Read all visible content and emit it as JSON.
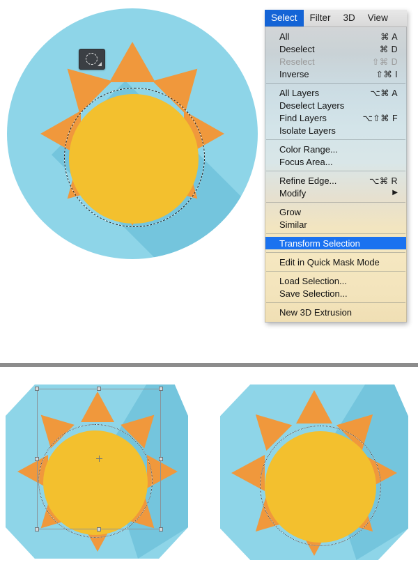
{
  "app": {
    "context": "Adobe Photoshop — Select menu open over a flat sun icon illustration"
  },
  "menubar": {
    "items": [
      {
        "label": "Select",
        "active": true
      },
      {
        "label": "Filter",
        "active": false
      },
      {
        "label": "3D",
        "active": false
      },
      {
        "label": "View",
        "active": false
      }
    ]
  },
  "select_menu": {
    "groups": [
      {
        "items": [
          {
            "label": "All",
            "shortcut": "⌘ A",
            "state": "enabled"
          },
          {
            "label": "Deselect",
            "shortcut": "⌘ D",
            "state": "enabled"
          },
          {
            "label": "Reselect",
            "shortcut": "⇧⌘ D",
            "state": "disabled"
          },
          {
            "label": "Inverse",
            "shortcut": "⇧⌘ I",
            "state": "enabled"
          }
        ]
      },
      {
        "items": [
          {
            "label": "All Layers",
            "shortcut": "⌥⌘ A",
            "state": "enabled"
          },
          {
            "label": "Deselect Layers",
            "shortcut": "",
            "state": "enabled"
          },
          {
            "label": "Find Layers",
            "shortcut": "⌥⇧⌘ F",
            "state": "enabled"
          },
          {
            "label": "Isolate Layers",
            "shortcut": "",
            "state": "enabled"
          }
        ]
      },
      {
        "items": [
          {
            "label": "Color Range...",
            "shortcut": "",
            "state": "enabled"
          },
          {
            "label": "Focus Area...",
            "shortcut": "",
            "state": "enabled"
          }
        ]
      },
      {
        "items": [
          {
            "label": "Refine Edge...",
            "shortcut": "⌥⌘ R",
            "state": "enabled"
          },
          {
            "label": "Modify",
            "shortcut": "",
            "state": "enabled",
            "submenu": true
          }
        ]
      },
      {
        "items": [
          {
            "label": "Grow",
            "shortcut": "",
            "state": "enabled"
          },
          {
            "label": "Similar",
            "shortcut": "",
            "state": "enabled"
          }
        ]
      },
      {
        "items": [
          {
            "label": "Transform Selection",
            "shortcut": "",
            "state": "selected"
          }
        ]
      },
      {
        "items": [
          {
            "label": "Edit in Quick Mask Mode",
            "shortcut": "",
            "state": "enabled"
          }
        ]
      },
      {
        "items": [
          {
            "label": "Load Selection...",
            "shortcut": "",
            "state": "enabled"
          },
          {
            "label": "Save Selection...",
            "shortcut": "",
            "state": "enabled"
          }
        ]
      },
      {
        "items": [
          {
            "label": "New 3D Extrusion",
            "shortcut": "",
            "state": "enabled"
          }
        ]
      }
    ]
  },
  "artwork": {
    "colors": {
      "background_disc": "#8ed5e8",
      "background_disc_shadow": "#74c5dd",
      "ray": "#f0983c",
      "core": "#f3c02e",
      "canvas": "#ffffff",
      "divider": "#8c8c8c",
      "selection_ants": "#1a1a1a",
      "menu_highlight": "#1b72f0",
      "menubar_highlight": "#1464d6"
    },
    "ray_count": 8,
    "tool_badge": {
      "icon": "elliptical-marquee-tool",
      "background": "#3b3f44"
    },
    "panels": [
      {
        "id": "top",
        "caption": "Elliptical selection active on the sun core"
      },
      {
        "id": "bottom-left",
        "caption": "Transform Selection bounding box with handles"
      },
      {
        "id": "bottom-right",
        "caption": "Scaled elliptical selection after transform"
      }
    ]
  }
}
